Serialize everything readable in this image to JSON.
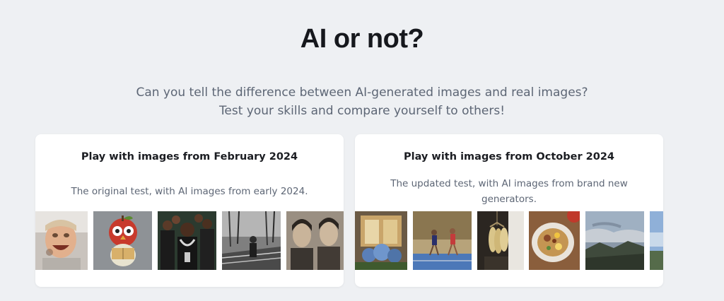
{
  "header": {
    "title": "AI or not?",
    "subtitle_line1": "Can you tell the difference between AI-generated images and real images?",
    "subtitle_line2": "Test your skills and compare yourself to others!"
  },
  "cards": [
    {
      "title": "Play with images from February 2024",
      "description": "The original test, with AI images from early 2024.",
      "thumbnails": [
        "laughing-child",
        "apple-owl-reading",
        "group-of-men",
        "bw-forest-worker",
        "two-women-portrait"
      ]
    },
    {
      "title": "Play with images from October 2024",
      "description": "The updated test, with AI images from brand new generators.",
      "thumbnails": [
        "storefront-flowers",
        "tennis-players",
        "hanging-corn",
        "food-plate",
        "mountain-sky",
        "sky-edge"
      ]
    }
  ],
  "colors": {
    "background": "#eef0f3",
    "title": "#16181d",
    "muted_text": "#5d6675",
    "card": "#ffffff"
  }
}
